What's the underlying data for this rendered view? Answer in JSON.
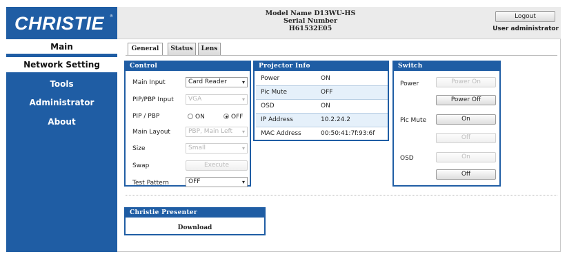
{
  "brand": {
    "logo_text": "CHRISTIE",
    "logo_mark": "®",
    "color": "#1f5da4"
  },
  "header": {
    "model": "Model Name D13WU-HS",
    "serial": "Serial Number H61532E05",
    "logout_label": "Logout",
    "user": "User administrator"
  },
  "sidebar": {
    "items": [
      {
        "label": "Main",
        "active": true
      },
      {
        "label": "Network Setting",
        "active": false
      },
      {
        "label": "Tools",
        "active": false
      },
      {
        "label": "Administrator",
        "active": false
      },
      {
        "label": "About",
        "active": false
      }
    ]
  },
  "tabs": [
    {
      "label": "General",
      "active": true
    },
    {
      "label": "Status",
      "active": false
    },
    {
      "label": "Lens",
      "active": false
    }
  ],
  "control": {
    "title": "Control",
    "main_input": {
      "label": "Main Input",
      "value": "Card Reader"
    },
    "pip_pbp_input": {
      "label": "PIP/PBP Input",
      "value": "VGA"
    },
    "pip_pbp": {
      "label": "PIP / PBP",
      "on_label": "ON",
      "off_label": "OFF",
      "selected": "OFF"
    },
    "main_layout": {
      "label": "Main Layout",
      "value": "PBP, Main Left"
    },
    "size": {
      "label": "Size",
      "value": "Small"
    },
    "swap": {
      "label": "Swap",
      "button": "Execute"
    },
    "test_pattern": {
      "label": "Test Pattern",
      "value": "OFF"
    }
  },
  "projector_info": {
    "title": "Projector Info",
    "rows": [
      {
        "key": "Power",
        "value": "ON"
      },
      {
        "key": "Pic Mute",
        "value": "OFF"
      },
      {
        "key": "OSD",
        "value": "ON"
      },
      {
        "key": "IP Address",
        "value": "10.2.24.2"
      },
      {
        "key": "MAC Address",
        "value": "00:50:41:7f:93:6f"
      }
    ]
  },
  "switch": {
    "title": "Switch",
    "power": {
      "label": "Power",
      "on": "Power On",
      "off": "Power Off"
    },
    "pic_mute": {
      "label": "Pic Mute",
      "on": "On",
      "off": "Off"
    },
    "osd": {
      "label": "OSD",
      "on": "On",
      "off": "Off"
    }
  },
  "presenter": {
    "title": "Christie Presenter",
    "download": "Download"
  }
}
